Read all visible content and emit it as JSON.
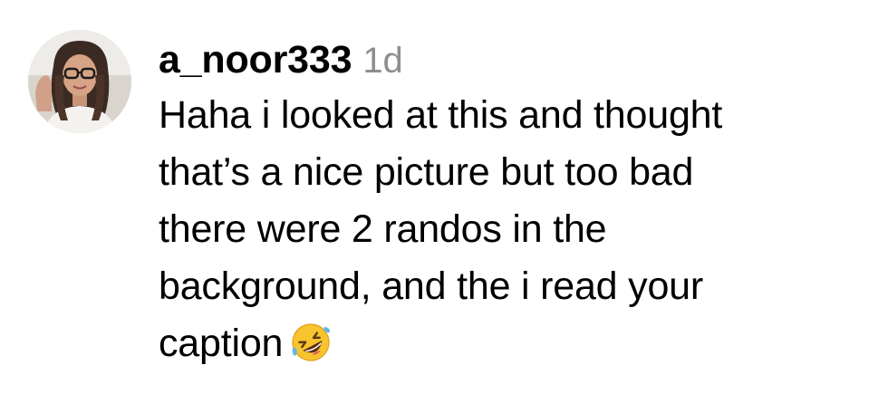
{
  "comment": {
    "username": "a_noor333",
    "timestamp": "1d",
    "lines": [
      "Haha i looked at this and thought",
      "that’s a nice picture but too bad",
      "there were 2 randos in the",
      "background, and the i read your",
      "caption"
    ],
    "emoji": "rolling-on-floor-laughing-icon"
  },
  "colors": {
    "text": "#000000",
    "timestamp": "#8e8e8e",
    "background": "#ffffff"
  }
}
